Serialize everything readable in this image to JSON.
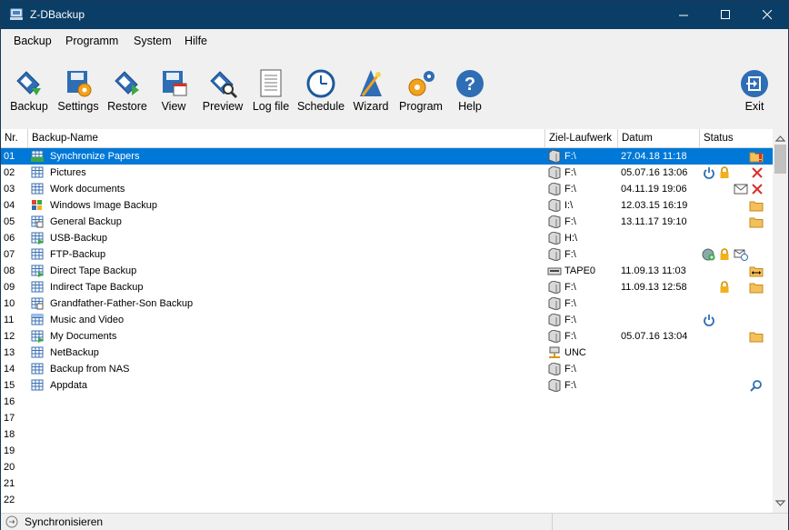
{
  "window": {
    "title": "Z-DBackup",
    "minimize_glyph": "—",
    "maximize_glyph": "☐",
    "close_glyph": "✕"
  },
  "menu": [
    "Backup",
    "Programm",
    "System",
    "Hilfe"
  ],
  "toolbar": [
    {
      "id": "backup",
      "label": "Backup",
      "icon": "backup-icon"
    },
    {
      "id": "settings",
      "label": "Settings",
      "icon": "settings-icon"
    },
    {
      "id": "restore",
      "label": "Restore",
      "icon": "restore-icon"
    },
    {
      "id": "view",
      "label": "View",
      "icon": "view-icon"
    },
    {
      "id": "preview",
      "label": "Preview",
      "icon": "preview-icon"
    },
    {
      "id": "logfile",
      "label": "Log file",
      "icon": "log-file-icon"
    },
    {
      "id": "schedule",
      "label": "Schedule",
      "icon": "clock-icon"
    },
    {
      "id": "wizard",
      "label": "Wizard",
      "icon": "wizard-icon"
    },
    {
      "id": "program",
      "label": "Program",
      "icon": "gears-icon"
    },
    {
      "id": "help",
      "label": "Help",
      "icon": "help-icon"
    },
    {
      "id": "exit",
      "label": "Exit",
      "icon": "exit-icon"
    }
  ],
  "columns": {
    "nr": "Nr.",
    "name": "Backup-Name",
    "drive": "Ziel-Laufwerk",
    "date": "Datum",
    "status": "Status"
  },
  "rows": [
    {
      "nr": "01",
      "name": "Synchronize Papers",
      "drive": "F:\\",
      "date": "27.04.18 11:18",
      "drive_icon": "drive",
      "row_icon": "sync",
      "status": [
        "folder-warning"
      ],
      "selected": true
    },
    {
      "nr": "02",
      "name": "Pictures",
      "drive": "F:\\",
      "date": "05.07.16 13:06",
      "drive_icon": "drive",
      "row_icon": "grid",
      "status": [
        "power",
        "lock",
        "error-x"
      ]
    },
    {
      "nr": "03",
      "name": "Work documents",
      "drive": "F:\\",
      "date": "04.11.19 19:06",
      "drive_icon": "drive",
      "row_icon": "grid",
      "status": [
        "mail",
        "error-x"
      ]
    },
    {
      "nr": "04",
      "name": "Windows Image Backup",
      "drive": "I:\\",
      "date": "12.03.15 16:19",
      "drive_icon": "drive",
      "row_icon": "windows",
      "status": [
        "folder"
      ]
    },
    {
      "nr": "05",
      "name": "General Backup",
      "drive": "F:\\",
      "date": "13.11.17 19:10",
      "drive_icon": "drive",
      "row_icon": "lock-grid",
      "status": [
        "folder"
      ]
    },
    {
      "nr": "06",
      "name": "USB-Backup",
      "drive": "H:\\",
      "date": "",
      "drive_icon": "drive",
      "row_icon": "green-grid",
      "status": []
    },
    {
      "nr": "07",
      "name": "FTP-Backup",
      "drive": "F:\\",
      "date": "",
      "drive_icon": "drive",
      "row_icon": "grid",
      "status": [
        "globe",
        "lock",
        "network-mail"
      ]
    },
    {
      "nr": "08",
      "name": "Direct Tape Backup",
      "drive": "TAPE0",
      "date": "11.09.13 11:03",
      "drive_icon": "tape",
      "row_icon": "green-grid",
      "status": [
        "folder-arrows"
      ]
    },
    {
      "nr": "09",
      "name": "Indirect Tape Backup",
      "drive": "F:\\",
      "date": "11.09.13 12:58",
      "drive_icon": "drive",
      "row_icon": "grid",
      "status": [
        "lock",
        "folder"
      ]
    },
    {
      "nr": "10",
      "name": "Grandfather-Father-Son Backup",
      "drive": "F:\\",
      "date": "",
      "drive_icon": "drive",
      "row_icon": "lock-grid",
      "status": []
    },
    {
      "nr": "11",
      "name": "Music and Video",
      "drive": "F:\\",
      "date": "",
      "drive_icon": "drive",
      "row_icon": "grid-blue",
      "status": [
        "power"
      ]
    },
    {
      "nr": "12",
      "name": "My Documents",
      "drive": "F:\\",
      "date": "05.07.16 13:04",
      "drive_icon": "drive",
      "row_icon": "green-grid",
      "status": [
        "folder"
      ]
    },
    {
      "nr": "13",
      "name": "NetBackup",
      "drive": "UNC",
      "date": "",
      "drive_icon": "network",
      "row_icon": "grid",
      "status": []
    },
    {
      "nr": "14",
      "name": "Backup from NAS",
      "drive": "F:\\",
      "date": "",
      "drive_icon": "drive",
      "row_icon": "grid",
      "status": []
    },
    {
      "nr": "15",
      "name": "Appdata",
      "drive": "F:\\",
      "date": "",
      "drive_icon": "drive",
      "row_icon": "grid",
      "status": [
        "search"
      ]
    },
    {
      "nr": "16",
      "name": "",
      "drive": "",
      "date": "",
      "status": []
    },
    {
      "nr": "17",
      "name": "",
      "drive": "",
      "date": "",
      "status": []
    },
    {
      "nr": "18",
      "name": "",
      "drive": "",
      "date": "",
      "status": []
    },
    {
      "nr": "19",
      "name": "",
      "drive": "",
      "date": "",
      "status": []
    },
    {
      "nr": "20",
      "name": "",
      "drive": "",
      "date": "",
      "status": []
    },
    {
      "nr": "21",
      "name": "",
      "drive": "",
      "date": "",
      "status": []
    },
    {
      "nr": "22",
      "name": "",
      "drive": "",
      "date": "",
      "status": []
    }
  ],
  "statusbar": {
    "text": "Synchronisieren",
    "icon": "arrow-circle-icon"
  },
  "colors": {
    "titlebar": "#0b3e66",
    "selection": "#0078d7",
    "accent_blue": "#2f6db5"
  }
}
